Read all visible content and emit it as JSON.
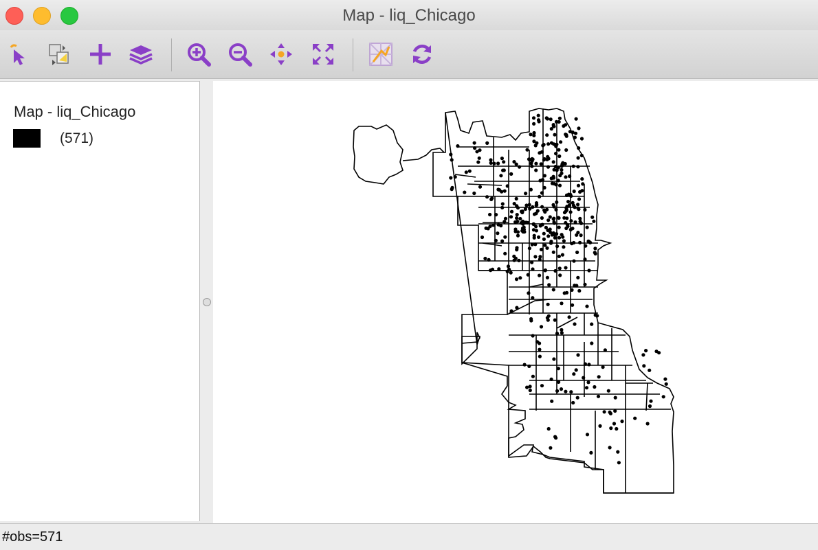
{
  "window": {
    "title": "Map - liq_Chicago"
  },
  "toolbar": {
    "accent": "#8a3fc7",
    "buttons": [
      {
        "name": "select-tool-button",
        "icon": "pointer-icon"
      },
      {
        "name": "copy-image-button",
        "icon": "copy-image-icon"
      },
      {
        "name": "add-layer-button",
        "icon": "plus-icon"
      },
      {
        "name": "layers-button",
        "icon": "layers-icon"
      },
      {
        "name": "zoom-in-button",
        "icon": "zoom-in-icon"
      },
      {
        "name": "zoom-out-button",
        "icon": "zoom-out-icon"
      },
      {
        "name": "pan-button",
        "icon": "pan-icon"
      },
      {
        "name": "full-extent-button",
        "icon": "full-extent-icon"
      },
      {
        "name": "basemap-button",
        "icon": "basemap-icon"
      },
      {
        "name": "refresh-button",
        "icon": "refresh-icon"
      }
    ]
  },
  "legend": {
    "title": "Map - liq_Chicago",
    "items": [
      {
        "swatch_color": "#000000",
        "label": "(571)"
      }
    ]
  },
  "status": {
    "text": "#obs=571"
  }
}
